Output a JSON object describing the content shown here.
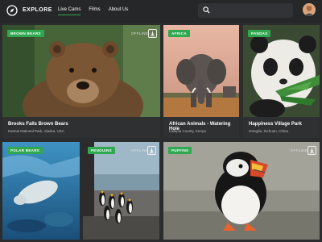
{
  "header": {
    "brand": "EXPLORE",
    "nav": [
      "Live Cams",
      "Films",
      "About Us"
    ],
    "active_nav": 0,
    "search_placeholder": ""
  },
  "colors": {
    "accent": "#2fa84f",
    "background": "#2b2c2e",
    "topbar": "#262729"
  },
  "cards": [
    {
      "badge": "BROWN BEARS",
      "title": "Brooks Falls Brown Bears",
      "location": "Katmai National Park, Alaska, USA",
      "offline": "OFFLINE"
    },
    {
      "badge": "AFRICA",
      "title": "African Animals - Watering Hole",
      "location": "Laikipia County, Kenya"
    },
    {
      "badge": "PANDAS",
      "title": "Happiness Village Park",
      "location": "Gengda, Sichuan, China"
    },
    {
      "badge": "POLAR BEARS"
    },
    {
      "badge": "PENGUINS",
      "offline": "OFFLINE"
    },
    {
      "badge": "PUFFINS",
      "offline": "OFFLINE"
    }
  ]
}
